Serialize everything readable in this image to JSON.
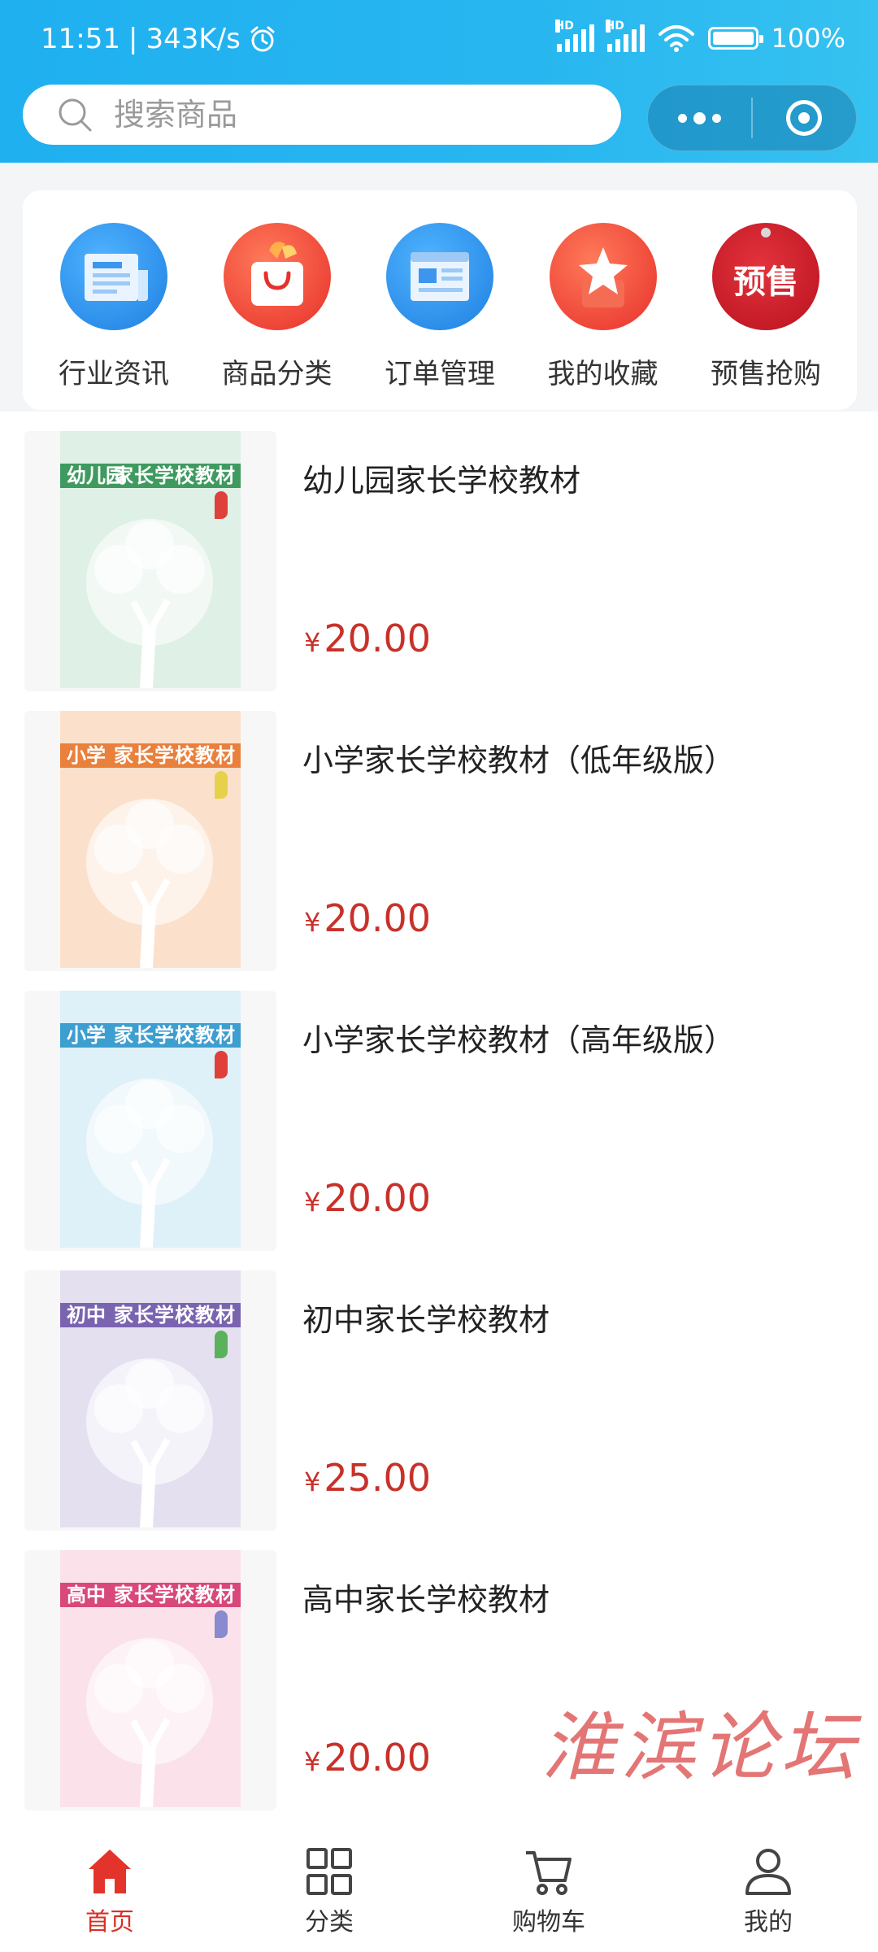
{
  "status_bar": {
    "time": "11:51",
    "network_speed": "343K/s",
    "alarm_icon": "alarm-clock-icon",
    "signal1_label": "HD",
    "signal2_label": "HD",
    "battery": "100%",
    "battery_level": 1.0
  },
  "search": {
    "placeholder": "搜索商品",
    "icon": "search-icon"
  },
  "capsule": {
    "more_icon": "more-dots-icon",
    "close_icon": "target-close-icon"
  },
  "categories": [
    {
      "label": "行业资讯",
      "icon": "newspaper-icon",
      "color": "#2d8ef0"
    },
    {
      "label": "商品分类",
      "icon": "shopping-bag-icon",
      "color": "#f04a3a"
    },
    {
      "label": "订单管理",
      "icon": "order-document-icon",
      "color": "#2d8ef0"
    },
    {
      "label": "我的收藏",
      "icon": "star-favorite-icon",
      "color": "#f04a3a"
    },
    {
      "label": "预售抢购",
      "icon": "presale-tag-icon",
      "icon_text": "预售",
      "color": "#d0232e"
    }
  ],
  "products": [
    {
      "title": "幼儿园家长学校教材",
      "currency": "¥",
      "price": "20.00",
      "cover": {
        "level": "幼儿园",
        "main": "家长学校教材",
        "bg": "#dff0e6",
        "band": "#3f9a5f",
        "accent": "#e0403a"
      }
    },
    {
      "title": "小学家长学校教材（低年级版）",
      "currency": "¥",
      "price": "20.00",
      "cover": {
        "level": "小学",
        "main": "家长学校教材",
        "bg": "#fbe0cc",
        "band": "#e9803c",
        "accent": "#e6d24a"
      }
    },
    {
      "title": "小学家长学校教材（高年级版）",
      "currency": "¥",
      "price": "20.00",
      "cover": {
        "level": "小学",
        "main": "家长学校教材",
        "bg": "#def0f8",
        "band": "#3d9ed0",
        "accent": "#e0403a"
      }
    },
    {
      "title": "初中家长学校教材",
      "currency": "¥",
      "price": "25.00",
      "cover": {
        "level": "初中",
        "main": "家长学校教材",
        "bg": "#e4e0f0",
        "band": "#7a64b0",
        "accent": "#5ab25a"
      }
    },
    {
      "title": "高中家长学校教材",
      "currency": "¥",
      "price": "20.00",
      "cover": {
        "level": "高中",
        "main": "家长学校教材",
        "bg": "#fbe2ea",
        "band": "#d8487a",
        "accent": "#8a8ad0"
      }
    }
  ],
  "watermark": "淮滨论坛",
  "tabbar": [
    {
      "label": "首页",
      "icon": "home-icon",
      "active": true
    },
    {
      "label": "分类",
      "icon": "grid-category-icon",
      "active": false
    },
    {
      "label": "购物车",
      "icon": "shopping-cart-icon",
      "active": false
    },
    {
      "label": "我的",
      "icon": "person-profile-icon",
      "active": false
    }
  ],
  "colors": {
    "header": "#28b6f0",
    "price": "#c8312a",
    "active_tab": "#d93025"
  }
}
